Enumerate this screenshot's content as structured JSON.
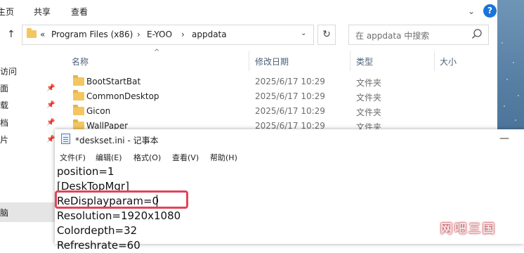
{
  "explorer": {
    "ribbon_tabs": [
      "主页",
      "共享",
      "查看"
    ],
    "expand_glyph": "⌄",
    "help_glyph": "?",
    "address": {
      "overflow": "«",
      "segments": [
        "Program Files (x86)",
        "E-YOO",
        "appdata"
      ],
      "separator": "›",
      "dropdown_glyph": "⌄",
      "refresh_glyph": "↻"
    },
    "search": {
      "placeholder": "在 appdata 中搜索",
      "icon": "search-icon"
    },
    "nav_pane": {
      "items": [
        "访问",
        "面",
        "载",
        "档",
        "片",
        "脑"
      ],
      "pin_glyph": "📌"
    },
    "columns": {
      "name": "名称",
      "date": "修改日期",
      "type": "类型",
      "size": "大小",
      "sort_glyph": "^"
    },
    "files": [
      {
        "name": "BootStartBat",
        "date": "2025/6/17 10:29",
        "type": "文件夹"
      },
      {
        "name": "CommonDesktop",
        "date": "2025/6/17 10:29",
        "type": "文件夹"
      },
      {
        "name": "Gicon",
        "date": "2025/6/17 10:29",
        "type": "文件夹"
      },
      {
        "name": "WallPaper",
        "date": "2025/6/17 10:29",
        "type": "文件夹"
      }
    ]
  },
  "notepad": {
    "title": "*deskset.ini - 记事本",
    "minimize_glyph": "—",
    "menu": [
      "文件(F)",
      "编辑(E)",
      "格式(O)",
      "查看(V)",
      "帮助(H)"
    ],
    "lines": [
      "position=1",
      "[DeskTopMgr]",
      "ReDisplayparam=0",
      "Resolution=1920x1080",
      "Colordepth=32",
      "Refreshrate=60"
    ]
  },
  "watermark": "网吧三国",
  "colors": {
    "highlight": "#e0445b",
    "folder": "#f3c65f",
    "accent": "#1a73d9"
  }
}
